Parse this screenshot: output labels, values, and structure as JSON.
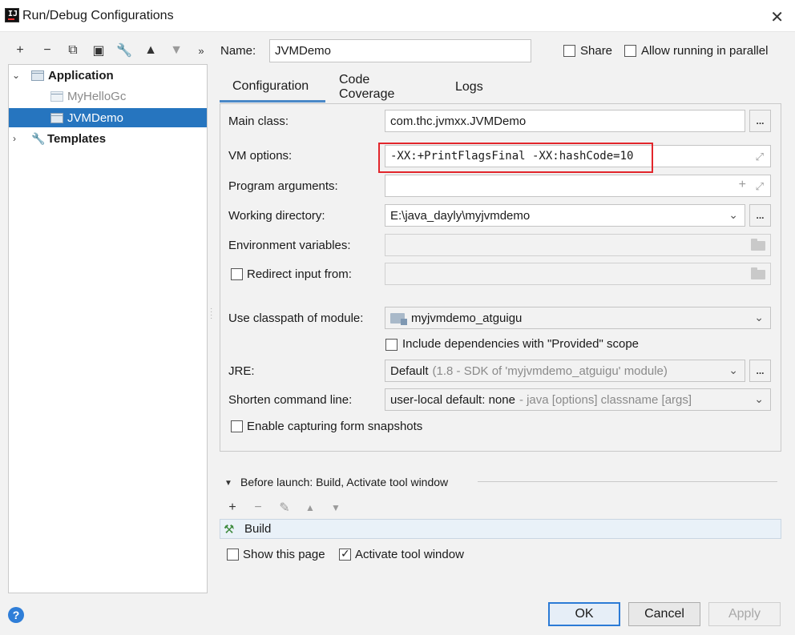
{
  "window": {
    "title": "Run/Debug Configurations"
  },
  "toolbar": {
    "icons": [
      "add-icon",
      "remove-icon",
      "copy-icon",
      "save-icon",
      "wrench-icon",
      "move-up-icon",
      "move-down-icon",
      "more-icon"
    ]
  },
  "tree": {
    "application": "Application",
    "items": [
      "MyHelloGc",
      "JVMDemo"
    ],
    "templates": "Templates"
  },
  "header": {
    "name_label": "Name:",
    "name_value": "JVMDemo",
    "share_label": "Share",
    "parallel_label": "Allow running in parallel"
  },
  "tabs": [
    "Configuration",
    "Code Coverage",
    "Logs"
  ],
  "form": {
    "main_class_label": "Main class:",
    "main_class_value": "com.thc.jvmxx.JVMDemo",
    "vm_options_label": "VM options:",
    "vm_options_value": "-XX:+PrintFlagsFinal -XX:hashCode=10",
    "program_args_label": "Program arguments:",
    "program_args_value": "",
    "working_dir_label": "Working directory:",
    "working_dir_value": "E:\\java_dayly\\myjvmdemo",
    "env_vars_label": "Environment variables:",
    "env_vars_value": "",
    "redirect_label": "Redirect input from:",
    "redirect_value": "",
    "classpath_label": "Use classpath of module:",
    "classpath_value": "myjvmdemo_atguigu",
    "include_deps_label": "Include dependencies with \"Provided\" scope",
    "jre_label": "JRE:",
    "jre_value": "Default",
    "jre_detail": "(1.8 - SDK of 'myjvmdemo_atguigu' module)",
    "shorten_label": "Shorten command line:",
    "shorten_value": "user-local default: none",
    "shorten_detail": "- java [options] classname [args]",
    "snapshots_label": "Enable capturing form snapshots",
    "dots": "..."
  },
  "before_launch": {
    "title": "Before launch: Build, Activate tool window",
    "items": [
      "Build"
    ],
    "show_page_label": "Show this page",
    "activate_label": "Activate tool window"
  },
  "buttons": {
    "ok": "OK",
    "cancel": "Cancel",
    "apply": "Apply",
    "help": "?"
  },
  "colors": {
    "selection": "#2675bf",
    "highlight_box": "#e2262c",
    "tab_underline": "#4a88c7",
    "primary_border": "#2c7bd6"
  }
}
